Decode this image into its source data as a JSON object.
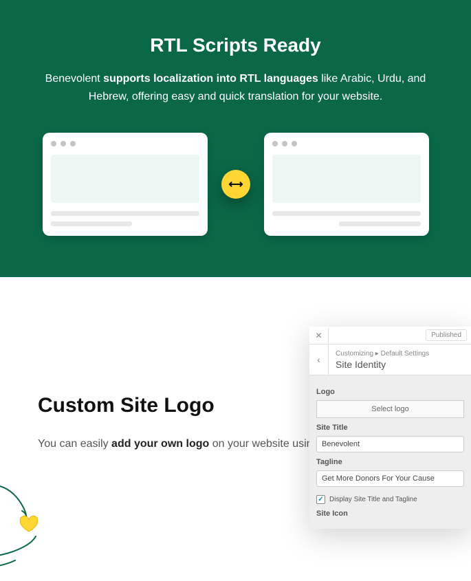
{
  "rtl": {
    "heading": "RTL Scripts Ready",
    "desc_pre": "Benevolent ",
    "desc_bold": "supports localization into RTL languages",
    "desc_post": " like Arabic, Urdu, and Hebrew, offering easy and quick translation for your website."
  },
  "logo": {
    "heading": "Custom Site Logo",
    "desc_pre": "You can easily ",
    "desc_bold": "add your own logo",
    "desc_post": " on your website using the Benevolent theme."
  },
  "customizer": {
    "published": "Published",
    "breadcrumb1": "Customizing  ▸  Default Settings",
    "breadcrumb2": "Site Identity",
    "logo_label": "Logo",
    "select_logo": "Select logo",
    "site_title_label": "Site Title",
    "site_title_value": "Benevolent",
    "tagline_label": "Tagline",
    "tagline_value": "Get More Donors For Your Cause",
    "display_check": "Display Site Title and Tagline",
    "site_icon_label": "Site Icon"
  }
}
